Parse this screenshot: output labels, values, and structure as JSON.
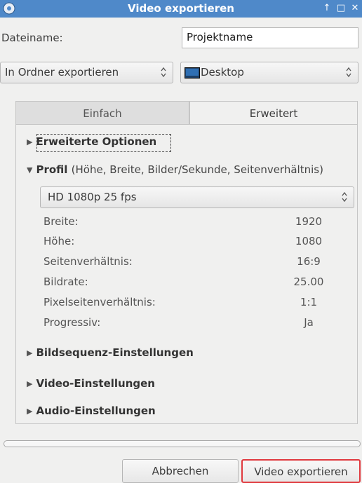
{
  "window": {
    "title": "Video exportieren",
    "controls": [
      "↑",
      "□",
      "✕"
    ]
  },
  "filename": {
    "label": "Dateiname:",
    "value": "Projektname"
  },
  "export_target": {
    "mode": "In Ordner exportieren",
    "folder": "Desktop"
  },
  "tabs": [
    {
      "label": "Einfach",
      "active": false
    },
    {
      "label": "Erweitert",
      "active": true
    }
  ],
  "sections": {
    "advanced_options": "Erweiterte Optionen",
    "profile": {
      "title": "Profil",
      "subtitle": "(Höhe, Breite, Bilder/Sekunde, Seitenverhältnis)"
    },
    "image_sequence": "Bildsequenz-Einstellungen",
    "video": "Video-Einstellungen",
    "audio": "Audio-Einstellungen"
  },
  "profile": {
    "selected": "HD 1080p 25 fps",
    "rows": [
      {
        "label": "Breite:",
        "value": "1920"
      },
      {
        "label": "Höhe:",
        "value": "1080"
      },
      {
        "label": "Seitenverhältnis:",
        "value": "16:9"
      },
      {
        "label": "Bildrate:",
        "value": "25.00"
      },
      {
        "label": "Pixelseitenverhältnis:",
        "value": "1:1"
      },
      {
        "label": "Progressiv:",
        "value": "Ja"
      }
    ]
  },
  "progress": 0,
  "buttons": {
    "cancel": "Abbrechen",
    "export": "Video exportieren"
  },
  "colors": {
    "titlebar": "#4f89c9",
    "highlight_border": "#e0393e"
  }
}
